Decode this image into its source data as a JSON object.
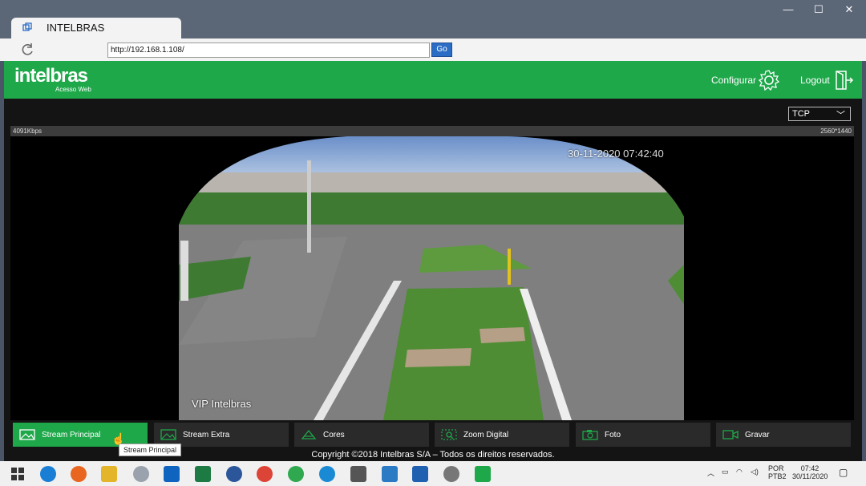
{
  "browser": {
    "tab_title": "INTELBRAS",
    "url": "http://192.168.1.108/",
    "go_label": "Go",
    "window_controls": [
      "—",
      "☐",
      "✕"
    ]
  },
  "app": {
    "logo": "intelbras",
    "logo_sub": "Acesso Web",
    "configure_label": "Configurar",
    "logout_label": "Logout",
    "protocol": "TCP",
    "bitrate": "4091Kbps",
    "resolution": "2560*1440",
    "camera_label": "VIP Intelbras",
    "camera_timestamp": "30-11-2020 07:42:40",
    "toolbar": [
      {
        "label": "Stream Principal",
        "icon": "image-icon"
      },
      {
        "label": "Stream Extra",
        "icon": "image-icon"
      },
      {
        "label": "Cores",
        "icon": "palette-icon"
      },
      {
        "label": "Zoom Digital",
        "icon": "zoom-icon"
      },
      {
        "label": "Foto",
        "icon": "camera-icon"
      },
      {
        "label": "Gravar",
        "icon": "video-icon"
      }
    ],
    "tooltip": "Stream Principal",
    "copyright": "Copyright ©2018 Intelbras S/A – Todos os direitos reservados.",
    "accent": "#1fa84a"
  },
  "taskbar": {
    "lang_1": "POR",
    "lang_2": "PTB2",
    "time": "07:42",
    "date": "30/11/2020"
  }
}
